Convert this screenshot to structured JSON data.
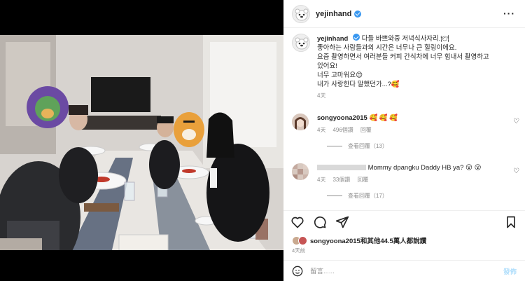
{
  "post": {
    "username": "yejinhand",
    "more_label": "···",
    "caption_lines": [
      "다들 바쁘와중 저녁식사자리.🍽",
      "좋아하는 사람들과의 시간은 너무나 큰 힐링이에요.",
      "요즘 촬영하면서 여러분들 커피 간식차에 너무 힘내서 촬영하고",
      "있어요!",
      "너무 고마워요😍",
      "내가 사랑한다 말했던가...?🥰"
    ],
    "caption_time": "4天"
  },
  "comments": [
    {
      "username": "songyoona2015",
      "text": "🥰 🥰 🥰",
      "time": "4天",
      "likes": "496個讚",
      "reply": "回覆",
      "view_replies": "查看回覆（13）"
    },
    {
      "username": "",
      "text": "Mommy dpangku Daddy HB ya? 😮 😮",
      "time": "4天",
      "likes": "33個讚",
      "reply": "回覆",
      "view_replies": "查看回覆（17）"
    }
  ],
  "likes": {
    "user": "songyoona2015",
    "rest": "和其他44.5萬人都說讚"
  },
  "posted_ago": "4天前",
  "add_comment": {
    "placeholder": "留言......",
    "post_label": "發佈"
  },
  "colors": {
    "verified": "#3897f0",
    "post_button": "#b2dffc",
    "secondary_text": "#8e8e8e"
  }
}
